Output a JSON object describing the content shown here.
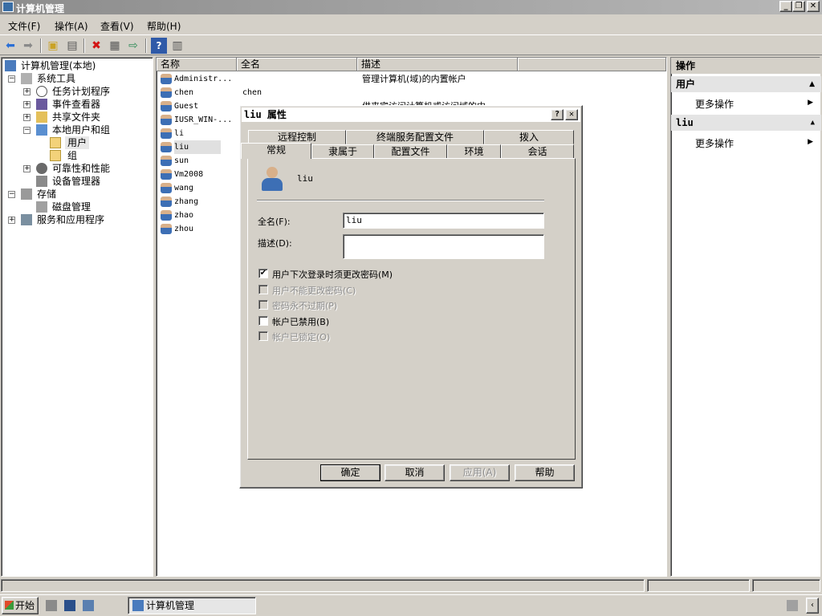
{
  "window": {
    "title": "计算机管理",
    "minimize": "_",
    "restore": "❐",
    "close": "✕"
  },
  "menu": [
    "文件(F)",
    "操作(A)",
    "查看(V)",
    "帮助(H)"
  ],
  "tree": {
    "root": "计算机管理(本地)",
    "system_tools": "系统工具",
    "task_scheduler": "任务计划程序",
    "event_viewer": "事件查看器",
    "shared_folders": "共享文件夹",
    "local_users": "本地用户和组",
    "users": "用户",
    "groups": "组",
    "reliability": "可靠性和性能",
    "device_manager": "设备管理器",
    "storage": "存储",
    "disk_mgmt": "磁盘管理",
    "services_apps": "服务和应用程序"
  },
  "list": {
    "columns": [
      "名称",
      "全名",
      "描述"
    ],
    "rows": [
      {
        "name": "Administr...",
        "full": "",
        "desc": "管理计算机(域)的内置帐户"
      },
      {
        "name": "chen",
        "full": "chen",
        "desc": ""
      },
      {
        "name": "Guest",
        "full": "",
        "desc": "供来宾访问计算机或访问域的内"
      },
      {
        "name": "IUSR_WIN-...",
        "full": "",
        "desc": ""
      },
      {
        "name": "li",
        "full": "",
        "desc": ""
      },
      {
        "name": "liu",
        "full": "",
        "desc": ""
      },
      {
        "name": "sun",
        "full": "",
        "desc": ""
      },
      {
        "name": "Vm2008",
        "full": "",
        "desc": ""
      },
      {
        "name": "wang",
        "full": "",
        "desc": ""
      },
      {
        "name": "zhang",
        "full": "",
        "desc": ""
      },
      {
        "name": "zhao",
        "full": "",
        "desc": ""
      },
      {
        "name": "zhou",
        "full": "",
        "desc": ""
      }
    ]
  },
  "actions": {
    "header": "操作",
    "section1": "用户",
    "section1_more": "更多操作",
    "section2": "liu",
    "section2_more": "更多操作"
  },
  "taskbar": {
    "start": "开始",
    "task": "计算机管理"
  },
  "dialog": {
    "title": "liu 属性",
    "help_btn": "?",
    "close_btn": "✕",
    "tabs_row1": [
      "远程控制",
      "终端服务配置文件",
      "拨入"
    ],
    "tabs_row2": [
      "常规",
      "隶属于",
      "配置文件",
      "环境",
      "会话"
    ],
    "username": "liu",
    "fullname_label": "全名(F):",
    "fullname_value": "liu",
    "desc_label": "描述(D):",
    "desc_value": "",
    "checkboxes": [
      {
        "label": "用户下次登录时须更改密码(M)",
        "checked": true,
        "enabled": true
      },
      {
        "label": "用户不能更改密码(C)",
        "checked": false,
        "enabled": false
      },
      {
        "label": "密码永不过期(P)",
        "checked": false,
        "enabled": false
      },
      {
        "label": "帐户已禁用(B)",
        "checked": false,
        "enabled": true
      },
      {
        "label": "帐户已锁定(O)",
        "checked": false,
        "enabled": false
      }
    ],
    "buttons": {
      "ok": "确定",
      "cancel": "取消",
      "apply": "应用(A)",
      "help": "帮助"
    }
  }
}
